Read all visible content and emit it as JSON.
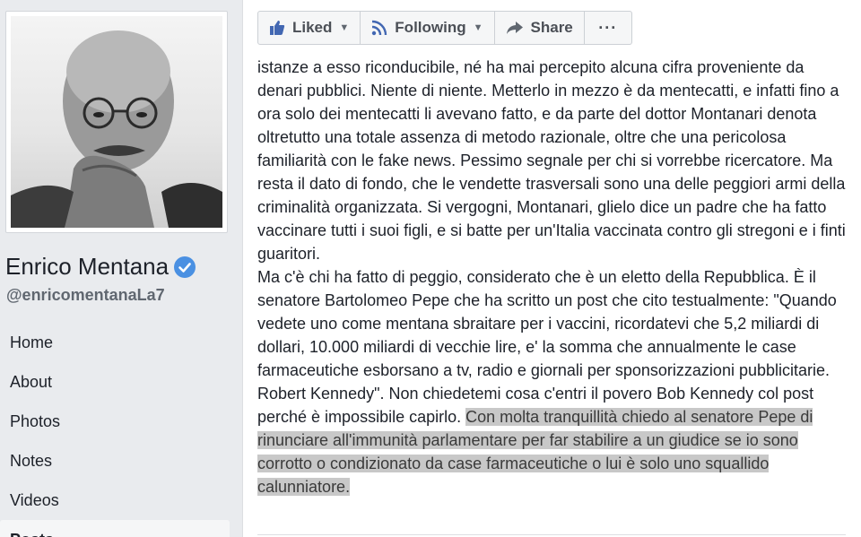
{
  "profile": {
    "name": "Enrico Mentana",
    "handle": "@enricomentanaLa7",
    "verified": true
  },
  "nav": {
    "items": [
      {
        "label": "Home"
      },
      {
        "label": "About"
      },
      {
        "label": "Photos"
      },
      {
        "label": "Notes"
      },
      {
        "label": "Videos"
      },
      {
        "label": "Posts"
      }
    ],
    "active": "Posts"
  },
  "actions": {
    "liked": "Liked",
    "following": "Following",
    "share": "Share",
    "more": "···"
  },
  "post": {
    "p1": "istanze a esso riconducibile, né ha mai percepito alcuna cifra proveniente da denari pubblici. Niente di niente. Metterlo in mezzo è da mentecatti, e infatti fino a ora solo dei mentecatti li avevano fatto, e da parte del dottor Montanari denota oltretutto una totale assenza di metodo razionale, oltre che una pericolosa familiarità con le fake news. Pessimo segnale per chi si vorrebbe ricercatore. Ma resta il dato di fondo, che le vendette trasversali sono una delle peggiori armi della criminalità organizzata. Si vergogni, Montanari, glielo dice un padre che ha fatto vaccinare tutti i suoi figli, e si batte per un'Italia vaccinata contro gli stregoni e i finti guaritori.",
    "p2": "Ma c'è chi ha fatto di peggio, considerato che è un eletto della Repubblica. È il senatore Bartolomeo Pepe che ha scritto un post che cito testualmente: \"Quando vedete uno come mentana sbraitare per i vaccini, ricordatevi che 5,2 miliardi di dollari, 10.000 miliardi di vecchie lire, e' la somma che annualmente le case farmaceutiche esborsano a tv, radio e giornali per sponsorizzazioni pubblicitarie.",
    "p3_plain": "Robert Kennedy\". Non chiedetemi cosa c'entri il povero Bob Kennedy col post perché è impossibile capirlo. ",
    "p3_highlight": "Con molta tranquillità chiedo al senatore Pepe di rinunciare all'immunità parlamentare per far stabilire a un giudice se io sono corrotto o condizionato da case farmaceutiche o lui è solo uno squallido calunniatore."
  },
  "icons": {
    "like": "thumbs-up-icon",
    "follow": "rss-icon",
    "share": "share-arrow-icon",
    "verified": "verified-badge-icon"
  },
  "colors": {
    "fb_blue": "#4267b2",
    "verified_blue": "#4a90e2",
    "highlight": "#c8c8c8"
  }
}
